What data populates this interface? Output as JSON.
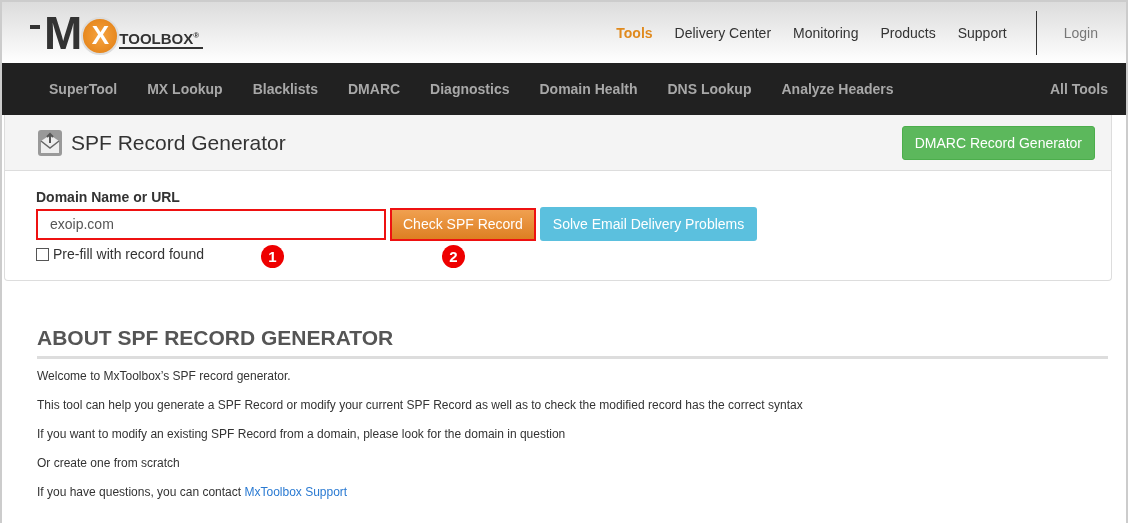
{
  "logo": {
    "letters": [
      "M",
      "X"
    ],
    "wordmark": "TOOLBOX",
    "registered": "®"
  },
  "top_nav": [
    {
      "label": "Tools",
      "selected": true
    },
    {
      "label": "Delivery Center",
      "selected": false
    },
    {
      "label": "Monitoring",
      "selected": false
    },
    {
      "label": "Products",
      "selected": false
    },
    {
      "label": "Support",
      "selected": false
    }
  ],
  "login": "Login",
  "tool_nav": [
    "SuperTool",
    "MX Lookup",
    "Blacklists",
    "DMARC",
    "Diagnostics",
    "Domain Health",
    "DNS Lookup",
    "Analyze Headers"
  ],
  "all_tools": "All Tools",
  "panel": {
    "title": "SPF Record Generator",
    "header_button": "DMARC Record Generator",
    "field_label": "Domain Name or URL",
    "field_value": "exoip.com",
    "check_button": "Check SPF Record",
    "help_button": "Solve Email Delivery Problems",
    "prefill": {
      "label": "Pre-fill with record found",
      "checked": false
    },
    "markers": [
      "1",
      "2"
    ]
  },
  "about": {
    "heading": "ABOUT SPF RECORD GENERATOR",
    "paragraphs": [
      "Welcome to MxToolbox’s SPF record generator.",
      "This tool can help you generate a SPF Record or modify your current SPF Record as well as to check the modified record has the correct syntax",
      "If you want to modify an existing SPF Record from a domain, please look for the domain in question",
      "Or create one from scratch"
    ],
    "contact": {
      "text": "If you have questions, you can contact ",
      "link": "MxToolbox Support"
    }
  }
}
